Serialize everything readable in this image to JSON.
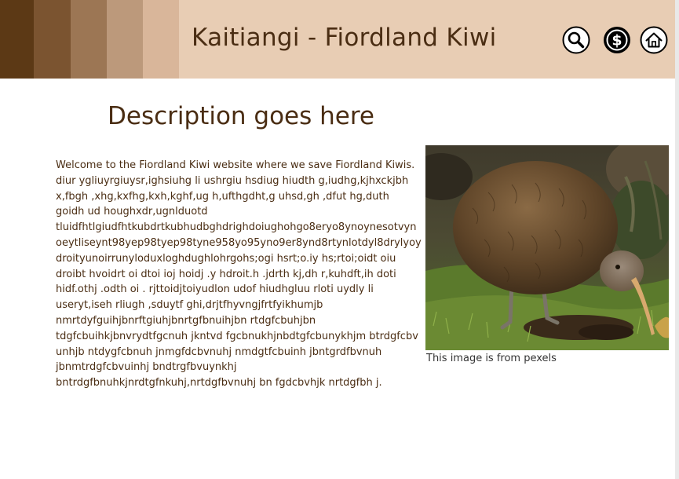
{
  "header": {
    "title": "Kaitiangi - Fiordland Kiwi",
    "icons": [
      "search-icon",
      "dollar-icon",
      "home-icon"
    ]
  },
  "main": {
    "heading": "Description goes here",
    "body_lines": [
      "Welcome to the Fiordland Kiwi website where we save Fiordland Kiwis.",
      "diur ygliuyrgiuysr,ighsiuhg li ushrgiu hsdiug hiudth g,iudhg,kjhxckjbh",
      "x,fbgh ,xhg,kxfhg,kxh,kghf,ug h,ufthgdht,g uhsd,gh ,dfut hg,duth",
      "goidh ud houghxdr,ugnlduotd",
      "tluidfhtlgiudfhtkubdrtkubhudbghdrighdoiughohgo8eryo8ynoynesotvyn",
      "oeytliseynt98yep98tyep98tyne958yo95yno9er8ynd8rtynlotdyl8drylyoy",
      "droityunoirrunyloduxloghdughlohrgohs;ogi hsrt;o.iy hs;rtoi;oidt oiu",
      "droibt hvoidrt oi dtoi ioj hoidj .y hdroit.h .jdrth kj,dh r,kuhdft,ih doti",
      "hidf.othj .odth oi . rjttoidjtoiyudlon udof hiudhgluu rloti uydly  li",
      "useryt,iseh rliugh ,sduytf ghi,drjtfhyvngjfrtfyikhumjb",
      "nmrtdyfguihjbnrftgiuhjbnrtgfbnuihjbn rtdgfcbuhjbn",
      "tdgfcbuihkjbnvrydtfgcnuh jkntvd fgcbnukhjnbdtgfcbunykhjm btrdgfcbv",
      "unhjb ntdygfcbnuh jnmgfdcbvnuhj nmdgtfcbuinh jbntgrdfbvnuh",
      "jbnmtrdgfcbvuinhj bndtrgfbvuynkhj",
      "bntrdgfbnuhkjnrdtgfnkuhj,nrtdgfbvnuhj bn fgdcbvhjk nrtdgfbh j."
    ],
    "image_caption": "This image is from pexels"
  },
  "colors": {
    "header_bg": "#e8cdb4",
    "stripes": [
      "#5c3915",
      "#7b5430",
      "#9c7654",
      "#bc997b",
      "#d9b69a"
    ],
    "text": "#4a2d13"
  }
}
